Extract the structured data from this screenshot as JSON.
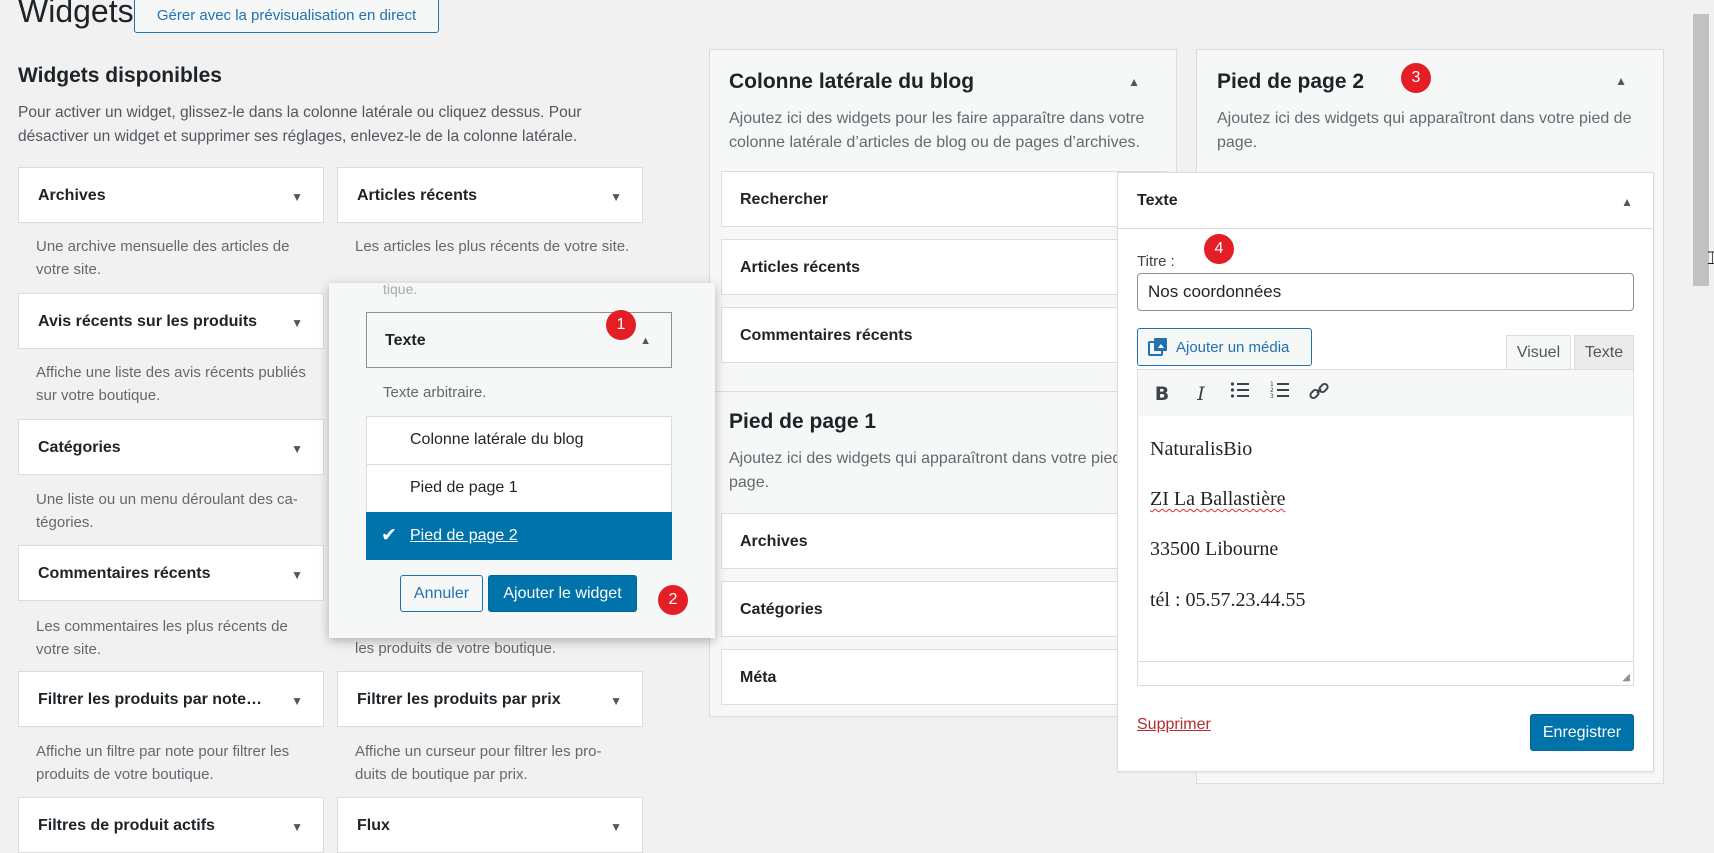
{
  "header": {
    "title": "Widgets",
    "live_button": "Gérer avec la prévisualisation en direct"
  },
  "available": {
    "heading": "Widgets disponibles",
    "description": "Pour activer un widget, glissez-le dans la colonne latérale ou cliquez dessus. Pour désactiver un widget et supprimer ses réglages, enlevez-le de la colonne latérale.",
    "widgets": [
      {
        "label": "Archives",
        "desc": "Une archive mensuelle des articles de votre site."
      },
      {
        "label": "Articles récents",
        "desc": "Les articles les plus récents de votre site."
      },
      {
        "label": "Avis récents sur les produits",
        "desc": "Affiche une liste des avis récents publiés sur votre boutique."
      },
      {
        "label": "Catégories",
        "desc": "Une liste ou un menu déroulant des ca-tégories."
      },
      {
        "label": "Commentaires récents",
        "desc": "Les commentaires les plus récents de votre site."
      },
      {
        "label": "Filtrer les produits par note…",
        "desc": "Affiche un filtre par note pour filtrer les produits de votre boutique."
      },
      {
        "label": "Filtrer les produits par prix",
        "desc": "Affiche un curseur pour filtrer les pro-duits de boutique par prix."
      },
      {
        "label": "Filtres de produit actifs",
        "desc": ""
      },
      {
        "label": "Flux",
        "desc": ""
      }
    ],
    "partial_desc_under_popup": "les produits de votre boutique.",
    "partial_desc_top": "tique."
  },
  "popup": {
    "widget_label": "Texte",
    "widget_desc": "Texte arbitraire.",
    "choices": [
      "Colonne latérale du blog",
      "Pied de page 1",
      "Pied de page 2"
    ],
    "selected_index": 2,
    "cancel": "Annuler",
    "add": "Ajouter le widget"
  },
  "sidebar_blog": {
    "title": "Colonne latérale du blog",
    "desc": "Ajoutez ici des widgets pour les faire apparaître dans votre colonne latérale d’articles de blog ou de pages d’archives.",
    "widgets": [
      "Rechercher",
      "Articles récents",
      "Commentaires récents"
    ]
  },
  "footer1": {
    "title": "Pied de page 1",
    "desc": "Ajoutez ici des widgets qui apparaîtront dans votre pied de page.",
    "widgets": [
      "Archives",
      "Catégories",
      "Méta"
    ]
  },
  "footer2": {
    "title": "Pied de page 2",
    "desc": "Ajoutez ici des widgets qui apparaîtront dans votre pied de page."
  },
  "text_widget": {
    "header": "Texte",
    "title_label": "Titre :",
    "title_value": "Nos coordonnées",
    "add_media": "Ajouter un média",
    "tab_visual": "Visuel",
    "tab_text": "Texte",
    "content": [
      "NaturalisBio",
      "ZI La Ballastière",
      "33500 Libourne",
      "tél  : 05.57.23.44.55"
    ],
    "delete": "Supprimer",
    "save": "Enregistrer"
  },
  "badges": [
    "1",
    "2",
    "3",
    "4"
  ],
  "colors": {
    "primary": "#0073aa",
    "badge": "#e31e24",
    "delete": "#b32d2e"
  }
}
